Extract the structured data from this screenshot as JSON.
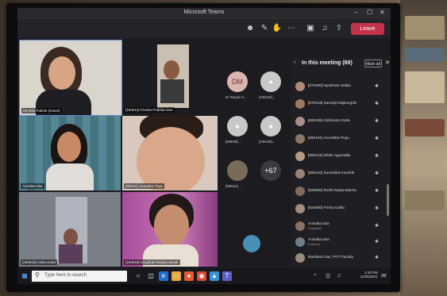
{
  "window": {
    "title": "Microsoft Teams",
    "controls": [
      "–",
      "☐",
      "✕"
    ]
  },
  "toolbar": {
    "leave_label": "Leave"
  },
  "video_tiles": [
    {
      "label": "Ms Ritu Pukhle (Guest)"
    },
    {
      "label": "[190012] Pranita Prakhar Deo"
    },
    {
      "label": "Anindita Das"
    },
    {
      "label": "[89916] Anuradha Pegu"
    },
    {
      "label": "[190018] Astha Dutta"
    },
    {
      "label": "[190018] Snigdhah Ranjan Borah"
    }
  ],
  "avatars": [
    {
      "initials": "DM",
      "label": "Dr Ranjan K..."
    },
    {
      "initials": "",
      "label": "[190190]..."
    },
    {
      "initials": "",
      "label": "[9090M]..."
    },
    {
      "initials": "",
      "label": "[190180]..."
    },
    {
      "initials": "",
      "label": "[890111] ..."
    },
    {
      "initials": "+67",
      "label": ""
    }
  ],
  "panel": {
    "title": "In this meeting (69)",
    "mute_all": "Mute all",
    "participants": [
      {
        "name": "[875290] Nyashree Saikia",
        "sub": ""
      },
      {
        "name": "[875418] Samarjit Rajkongshi",
        "sub": ""
      },
      {
        "name": "[890185] Abhilmoto Dutta",
        "sub": ""
      },
      {
        "name": "[890181] Anuradha Pegu",
        "sub": ""
      },
      {
        "name": "[890215] Dhlek Agarwalla",
        "sub": ""
      },
      {
        "name": "[890210] Suvashita Koushik",
        "sub": ""
      },
      {
        "name": "[925080] Rushi Ranja Baicha",
        "sub": ""
      },
      {
        "name": "[925080] Prisha Kalita",
        "sub": ""
      },
      {
        "name": "Anindita Das",
        "sub": "Organizer"
      },
      {
        "name": "Anindita Das",
        "sub": "External"
      },
      {
        "name": "Bandana Das, PGT Faculty",
        "sub": ""
      }
    ]
  },
  "taskbar": {
    "search_placeholder": "Type here to search",
    "time": "4:40 PM",
    "date": "11/05/2021"
  }
}
